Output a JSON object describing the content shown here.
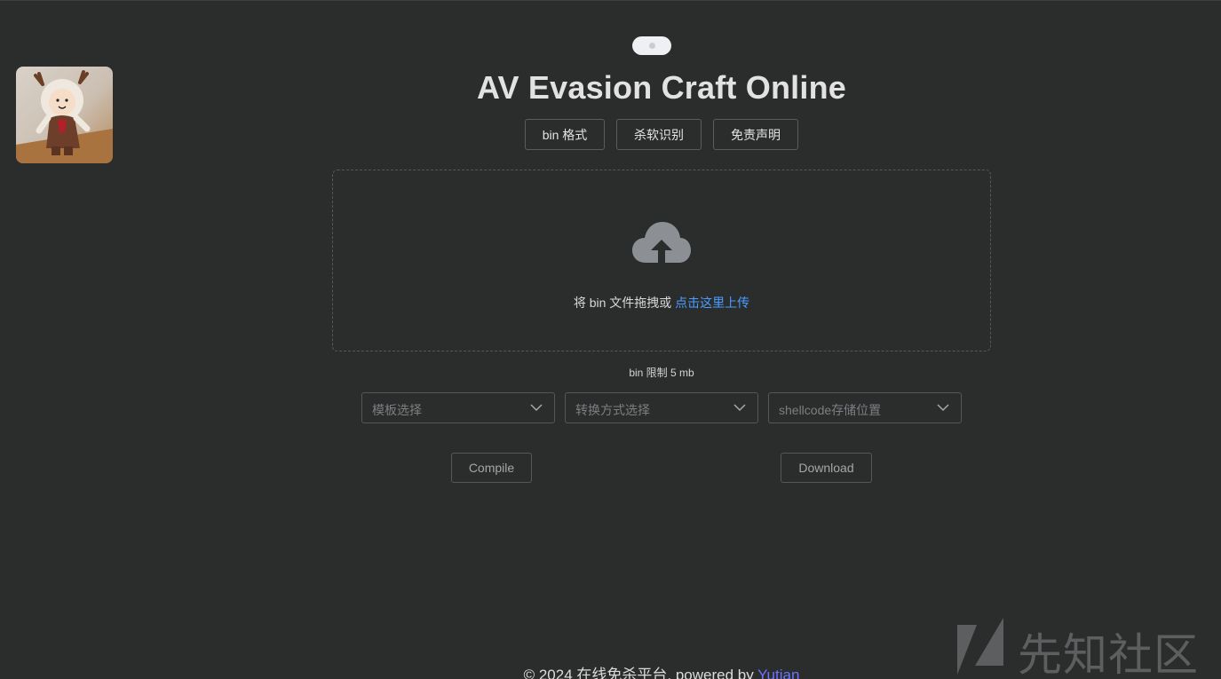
{
  "header": {
    "title": "AV Evasion Craft Online"
  },
  "nav": {
    "items": [
      {
        "label": "bin 格式"
      },
      {
        "label": "杀软识别"
      },
      {
        "label": "免责声明"
      }
    ]
  },
  "upload": {
    "text": "将 bin 文件拖拽或 ",
    "link": "点击这里上传",
    "limit": "bin 限制 5 mb"
  },
  "selects": [
    {
      "placeholder": "模板选择"
    },
    {
      "placeholder": "转换方式选择"
    },
    {
      "placeholder": "shellcode存储位置"
    }
  ],
  "actions": {
    "compile": "Compile",
    "download": "Download"
  },
  "footer": {
    "text": "© 2024 在线免杀平台, powered by ",
    "link": "Yutian"
  },
  "watermark": {
    "text": "先知社区"
  },
  "icons": {
    "upload": "cloud-upload-icon",
    "select_arrow": "chevron-down-icon",
    "theme": "theme-toggle"
  },
  "colors": {
    "background": "#2b2c2c",
    "link": "#4a9eff",
    "footer_link": "#6b73ff"
  }
}
